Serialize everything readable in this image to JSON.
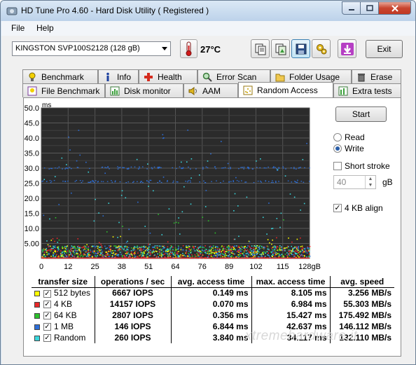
{
  "window": {
    "title": "HD Tune Pro 4.60 - Hard Disk Utility  (  Registered )"
  },
  "menu": {
    "items": [
      "File",
      "Help"
    ]
  },
  "toolbar": {
    "drive": "KINGSTON SVP100S2128     (128 gB)",
    "temperature": "27°C",
    "exit_label": "Exit"
  },
  "tabs": {
    "row1": [
      "Benchmark",
      "Info",
      "Health",
      "Error Scan",
      "Folder Usage",
      "Erase"
    ],
    "row2": [
      "File Benchmark",
      "Disk monitor",
      "AAM",
      "Random Access",
      "Extra tests"
    ],
    "active": "Random Access"
  },
  "controls": {
    "start_label": "Start",
    "read_label": "Read",
    "write_label": "Write",
    "mode_selected": "Write",
    "short_stroke_label": "Short stroke",
    "short_stroke_checked": false,
    "short_stroke_value": "40",
    "unit_gb": "gB",
    "align_label": "4 KB align",
    "align_checked": true
  },
  "chart_data": {
    "type": "scatter",
    "ylabel": "ms",
    "ylim": [
      0,
      50
    ],
    "yticks": [
      "50.0",
      "45.0",
      "40.0",
      "35.0",
      "30.0",
      "25.0",
      "20.0",
      "15.0",
      "10.0",
      "5.00"
    ],
    "xlim": [
      0,
      128
    ],
    "xticks": [
      "0",
      "12",
      "25",
      "38",
      "51",
      "64",
      "76",
      "89",
      "102",
      "115",
      "128gB"
    ],
    "grid": true,
    "series": [
      {
        "name": "512 bytes",
        "color": "#ffff00",
        "y_range_ms": [
          0,
          8.105
        ],
        "typical_ms": 0.149
      },
      {
        "name": "4 KB",
        "color": "#e8282a",
        "y_range_ms": [
          0,
          6.984
        ],
        "typical_ms": 0.07
      },
      {
        "name": "64 KB",
        "color": "#2cc02c",
        "y_range_ms": [
          0,
          15.427
        ],
        "typical_ms": 0.356
      },
      {
        "name": "1 MB",
        "color": "#2c6ed8",
        "y_range_ms": [
          0,
          42.637
        ],
        "typical_ms": 6.844
      },
      {
        "name": "Random",
        "color": "#3ad6dc",
        "y_range_ms": [
          0,
          34.117
        ],
        "typical_ms": 3.84
      }
    ],
    "bands_ms": [
      {
        "series": "1 MB",
        "ms": 25.5
      },
      {
        "series": "1 MB",
        "ms": 30.0
      }
    ]
  },
  "results": {
    "headers": [
      "transfer size",
      "operations / sec",
      "avg. access time",
      "max. access time",
      "avg. speed"
    ],
    "rows": [
      {
        "label": "512 bytes",
        "color": "#ffff00",
        "ops": "6667 IOPS",
        "avg": "0.149 ms",
        "max": "8.105 ms",
        "speed": "3.256 MB/s"
      },
      {
        "label": "4 KB",
        "color": "#e8282a",
        "ops": "14157 IOPS",
        "avg": "0.070 ms",
        "max": "6.984 ms",
        "speed": "55.303 MB/s"
      },
      {
        "label": "64 KB",
        "color": "#2cc02c",
        "ops": "2807 IOPS",
        "avg": "0.356 ms",
        "max": "15.427 ms",
        "speed": "175.492 MB/s"
      },
      {
        "label": "1 MB",
        "color": "#2c6ed8",
        "ops": "146 IOPS",
        "avg": "6.844 ms",
        "max": "42.637 ms",
        "speed": "146.112 MB/s"
      },
      {
        "label": "Random",
        "color": "#3ad6dc",
        "ops": "260 IOPS",
        "avg": "3.840 ms",
        "max": "34.117 ms",
        "speed": "132.110 MB/s"
      }
    ]
  },
  "watermark": "xtremehardware.it"
}
